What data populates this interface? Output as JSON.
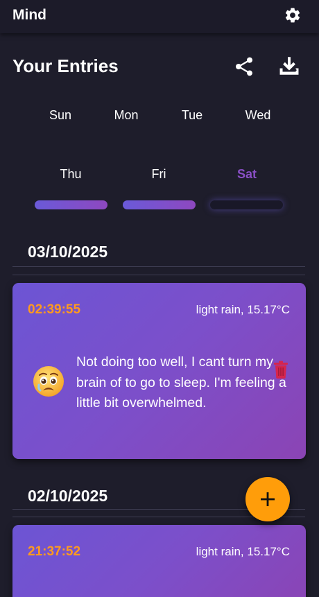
{
  "app": {
    "title": "Mind"
  },
  "header": {
    "title": "Your Entries"
  },
  "icons": {
    "settings": "gear-icon",
    "share": "share-icon",
    "download": "download-icon",
    "delete": "trash-icon",
    "add": "plus-icon",
    "mood": "worried-face-emoji"
  },
  "week": {
    "days": [
      {
        "label": "Sun",
        "has_entry": null
      },
      {
        "label": "Mon",
        "has_entry": null
      },
      {
        "label": "Tue",
        "has_entry": null
      },
      {
        "label": "Wed",
        "has_entry": null
      },
      {
        "label": "Thu",
        "has_entry": true
      },
      {
        "label": "Fri",
        "has_entry": true
      },
      {
        "label": "Sat",
        "has_entry": false,
        "selected": true
      }
    ]
  },
  "colors": {
    "background": "#1e1d2b",
    "accent_orange": "#ff9d0a",
    "selected_day": "#8a4fc6",
    "card_gradient_start": "#6c55d4",
    "card_gradient_end": "#8b44b4",
    "delete_red": "#d6254d"
  },
  "groups": [
    {
      "date": "03/10/2025",
      "entries": [
        {
          "time": "02:39:55",
          "weather": "light rain, 15.17°C",
          "text": "Not doing too well, I cant turn my brain of to go to sleep. I'm feeling a little bit overwhelmed."
        }
      ]
    },
    {
      "date": "02/10/2025",
      "entries": [
        {
          "time": "21:37:52",
          "weather": "light rain, 15.17°C",
          "text": ""
        }
      ]
    }
  ]
}
